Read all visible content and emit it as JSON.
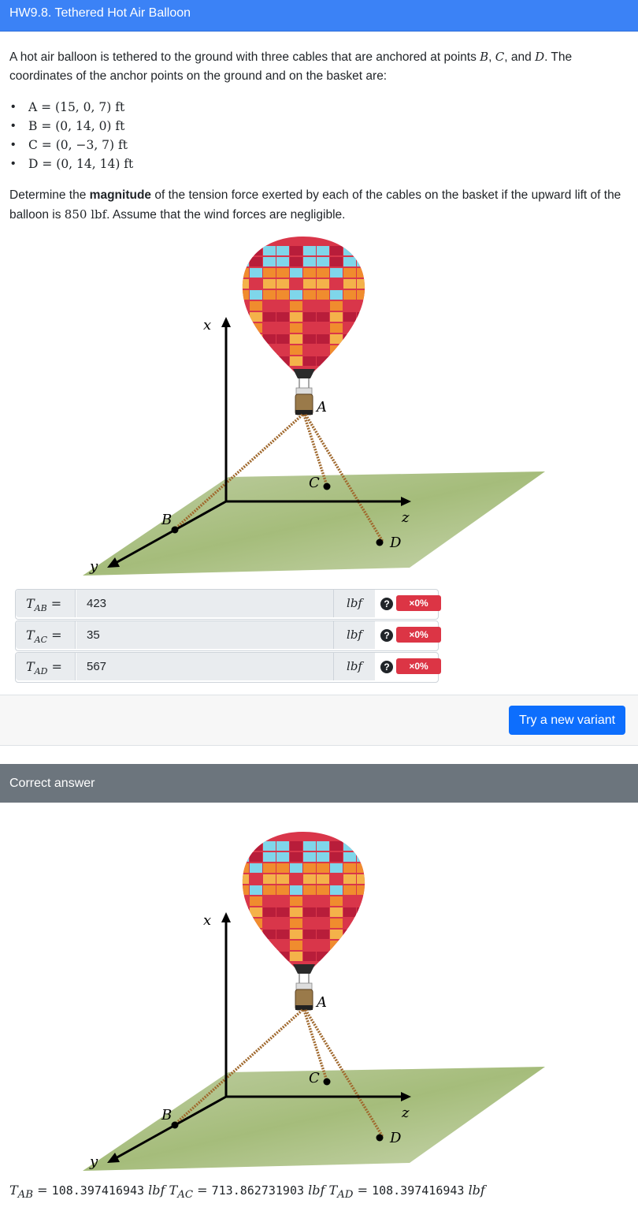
{
  "header": {
    "title": "HW9.8. Tethered Hot Air Balloon"
  },
  "problem": {
    "intro_1": "A hot air balloon is tethered to the ground with three cables that are anchored at points ",
    "intro_B": "B",
    "intro_sep1": ", ",
    "intro_C": "C",
    "intro_sep2": ", and ",
    "intro_D": "D",
    "intro_2": ". The coordinates of the anchor points on the ground and on the basket are:",
    "points": [
      "A = (15, 0, 7) ft",
      "B = (0, 14, 0) ft",
      "C = (0, −3, 7) ft",
      "D = (0, 14, 14) ft"
    ],
    "q_1": "Determine the ",
    "q_bold": "magnitude",
    "q_2": " of the tension force exerted by each of the cables on the basket if the upward lift of the balloon is ",
    "q_lift": "850 lbf",
    "q_3": ". Assume that the wind forces are negligible."
  },
  "figure": {
    "axis_x": "x",
    "axis_y": "y",
    "axis_z": "z",
    "label_A": "A",
    "label_B": "B",
    "label_C": "C",
    "label_D": "D",
    "balloon_colors": [
      "#d9364a",
      "#f08c2e",
      "#7fd6ea",
      "#b81d3a",
      "#f4b24a"
    ]
  },
  "answers": [
    {
      "label": "T",
      "sub": "AB",
      "value": "423",
      "unit": "lbf",
      "help": "?",
      "score": "×0%"
    },
    {
      "label": "T",
      "sub": "AC",
      "value": "35",
      "unit": "lbf",
      "help": "?",
      "score": "×0%"
    },
    {
      "label": "T",
      "sub": "AD",
      "value": "567",
      "unit": "lbf",
      "help": "?",
      "score": "×0%"
    }
  ],
  "actions": {
    "variant_button": "Try a new variant"
  },
  "correct": {
    "title": "Correct answer",
    "tab_label": "T",
    "tab_sub": "AB",
    "tab_value": "108.397416943",
    "tab_unit": "lbf",
    "tac_label": "T",
    "tac_sub": "AC",
    "tac_value": "713.862731903",
    "tac_unit": "lbf",
    "tad_label": "T",
    "tad_sub": "AD",
    "tad_value": "108.397416943",
    "tad_unit": "lbf"
  }
}
